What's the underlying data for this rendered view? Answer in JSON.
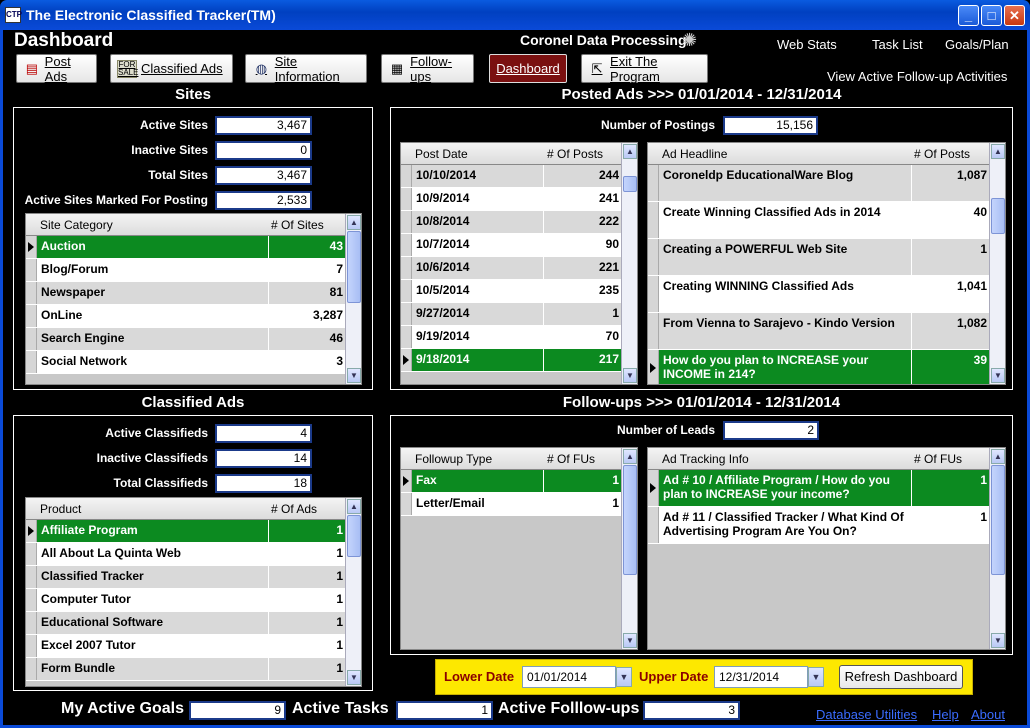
{
  "window": {
    "title": "The Electronic Classified Tracker(TM)",
    "icon_text": "CTP"
  },
  "header": {
    "title": "Dashboard",
    "company": "Coronel Data Processing"
  },
  "top_links": {
    "web_stats": "Web Stats",
    "task_list": "Task List",
    "goals_plan": "Goals/Plan",
    "view_followups": "View Active Follow-up Activities"
  },
  "toolbar": {
    "post_ads": "Post Ads",
    "classified_ads": "Classified Ads",
    "site_information": "Site Information",
    "followups": "Follow-ups",
    "dashboard": "Dashboard",
    "exit": "Exit The Program"
  },
  "sites": {
    "title": "Sites",
    "active_label": "Active Sites",
    "active": "3,467",
    "inactive_label": "Inactive Sites",
    "inactive": "0",
    "total_label": "Total Sites",
    "total": "3,467",
    "marked_label": "Active Sites Marked For Posting",
    "marked": "2,533",
    "col1": "Site Category",
    "col2": "# Of Sites",
    "rows": [
      {
        "name": "Auction",
        "count": "43"
      },
      {
        "name": "Blog/Forum",
        "count": "7"
      },
      {
        "name": "Newspaper",
        "count": "81"
      },
      {
        "name": "OnLine",
        "count": "3,287"
      },
      {
        "name": "Search Engine",
        "count": "46"
      },
      {
        "name": "Social Network",
        "count": "3"
      }
    ]
  },
  "posted": {
    "title": "Posted Ads >>> 01/01/2014 - 12/31/2014",
    "num_label": "Number of Postings",
    "num": "15,156",
    "col1": "Post Date",
    "col2": "# Of Posts",
    "rows": [
      {
        "date": "10/10/2014",
        "count": "244"
      },
      {
        "date": "10/9/2014",
        "count": "241"
      },
      {
        "date": "10/8/2014",
        "count": "222"
      },
      {
        "date": "10/7/2014",
        "count": "90"
      },
      {
        "date": "10/6/2014",
        "count": "221"
      },
      {
        "date": "10/5/2014",
        "count": "235"
      },
      {
        "date": "9/27/2014",
        "count": "1"
      },
      {
        "date": "9/19/2014",
        "count": "70"
      },
      {
        "date": "9/18/2014",
        "count": "217"
      }
    ],
    "hcol1": "Ad Headline",
    "hcol2": "# Of Posts",
    "headlines": [
      {
        "text": "Coroneldp EducationalWare Blog",
        "count": "1,087"
      },
      {
        "text": "Create Winning Classified Ads in 2014",
        "count": "40"
      },
      {
        "text": "Creating a POWERFUL Web Site",
        "count": "1"
      },
      {
        "text": "Creating WINNING Classified Ads",
        "count": "1,041"
      },
      {
        "text": "From Vienna to Sarajevo - Kindo Version",
        "count": "1,082"
      },
      {
        "text": "How do you plan to INCREASE your INCOME in 214?",
        "count": "39"
      }
    ]
  },
  "classified": {
    "title": "Classified Ads",
    "active_label": "Active Classifieds",
    "active": "4",
    "inactive_label": "Inactive Classifieds",
    "inactive": "14",
    "total_label": "Total Classifieds",
    "total": "18",
    "col1": "Product",
    "col2": "# Of Ads",
    "rows": [
      {
        "name": "Affiliate Program",
        "count": "1"
      },
      {
        "name": "All About La Quinta Web",
        "count": "1"
      },
      {
        "name": "Classified Tracker",
        "count": "1"
      },
      {
        "name": "Computer Tutor",
        "count": "1"
      },
      {
        "name": "Educational Software",
        "count": "1"
      },
      {
        "name": "Excel 2007 Tutor",
        "count": "1"
      },
      {
        "name": "Form Bundle",
        "count": "1"
      }
    ]
  },
  "followups": {
    "title": "Follow-ups >>> 01/01/2014 - 12/31/2014",
    "leads_label": "Number of Leads",
    "leads": "2",
    "col1": "Followup Type",
    "col2": "# Of FUs",
    "rows": [
      {
        "type": "Fax",
        "count": "1"
      },
      {
        "type": "Letter/Email",
        "count": "1"
      }
    ],
    "tcol1": "Ad Tracking Info",
    "tcol2": "# Of FUs",
    "tracking": [
      {
        "text": "Ad # 10 / Affiliate Program / How do you plan to INCREASE your income?",
        "count": "1"
      },
      {
        "text": "Ad # 11 / Classified Tracker / What Kind Of Advertising Program Are You On?",
        "count": "1"
      }
    ]
  },
  "dates": {
    "lower_label": "Lower Date",
    "lower": "01/01/2014",
    "upper_label": "Upper Date",
    "upper": "12/31/2014",
    "refresh": "Refresh Dashboard"
  },
  "bottom": {
    "goals_label": "My Active Goals",
    "goals": "9",
    "tasks_label": "Active Tasks",
    "tasks": "1",
    "fu_label": "Active Folllow-ups",
    "fu": "3",
    "db_utils": "Database Utilities",
    "help": "Help",
    "about": "About"
  },
  "colors": {
    "highlight": "#0c8a20",
    "active_button": "#7a1010",
    "date_bar": "#fde800",
    "title_bar": "#0040c0"
  }
}
